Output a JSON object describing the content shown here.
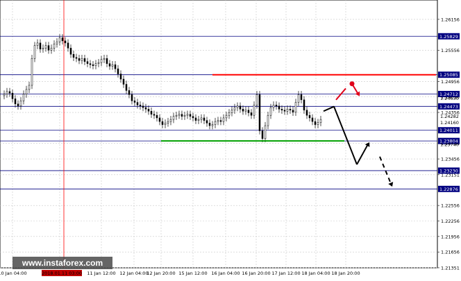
{
  "chart": {
    "background": "#ffffff",
    "grid_color": "#c8c8c8",
    "axis_color": "#000000",
    "candle_color": "#000000",
    "level_color": "#000080",
    "level_label_bg": "#000080",
    "resistance_color": "#ff0000",
    "support_color": "#00a000",
    "arrow_black": "#000000",
    "arrow_red": "#e0001a",
    "cursor_line_color": "#ff0000"
  },
  "price_axis": {
    "ticks": [
      "1.26156",
      "1.25556",
      "1.24956",
      "1.24656",
      "1.24356",
      "1.23756",
      "1.23456",
      "1.23151",
      "1.22556",
      "1.22256",
      "1.21956",
      "1.21656",
      "1.21351"
    ]
  },
  "time_axis": {
    "ticks": [
      "10 Jan 04:00",
      "10 Jan 20:00",
      "11 Jan 12:00",
      "12 Jan 04:00",
      "12 Jan 20:00",
      "15 Jan 12:00",
      "16 Jan 04:00",
      "16 Jan 20:00",
      "17 Jan 12:00",
      "18 Jan 04:00",
      "18 Jan 20:00"
    ],
    "highlight_label": "2018.01.11 03:00"
  },
  "levels": [
    "1.25829",
    "1.25085",
    "1.24712",
    "1.24473",
    "1.24011",
    "1.23804",
    "1.23230",
    "1.22876"
  ],
  "current_price_labels": [
    "1.24630",
    "1.24282",
    "1.24160",
    "1.23740"
  ],
  "watermark": {
    "text": "www.instaforex.com"
  },
  "chart_data": {
    "type": "candlestick",
    "x": [
      "10 Jan 04:00",
      "10 Jan 20:00",
      "11 Jan 12:00",
      "12 Jan 04:00",
      "12 Jan 20:00",
      "15 Jan 12:00",
      "16 Jan 04:00",
      "16 Jan 20:00",
      "17 Jan 12:00",
      "18 Jan 04:00",
      "18 Jan 20:00"
    ],
    "levels": [
      1.25829,
      1.25085,
      1.24712,
      1.24473,
      1.24011,
      1.23804,
      1.2323,
      1.22876
    ],
    "resistance": 1.25085,
    "support": 1.23804,
    "ylim": [
      1.2135,
      1.2645
    ]
  }
}
